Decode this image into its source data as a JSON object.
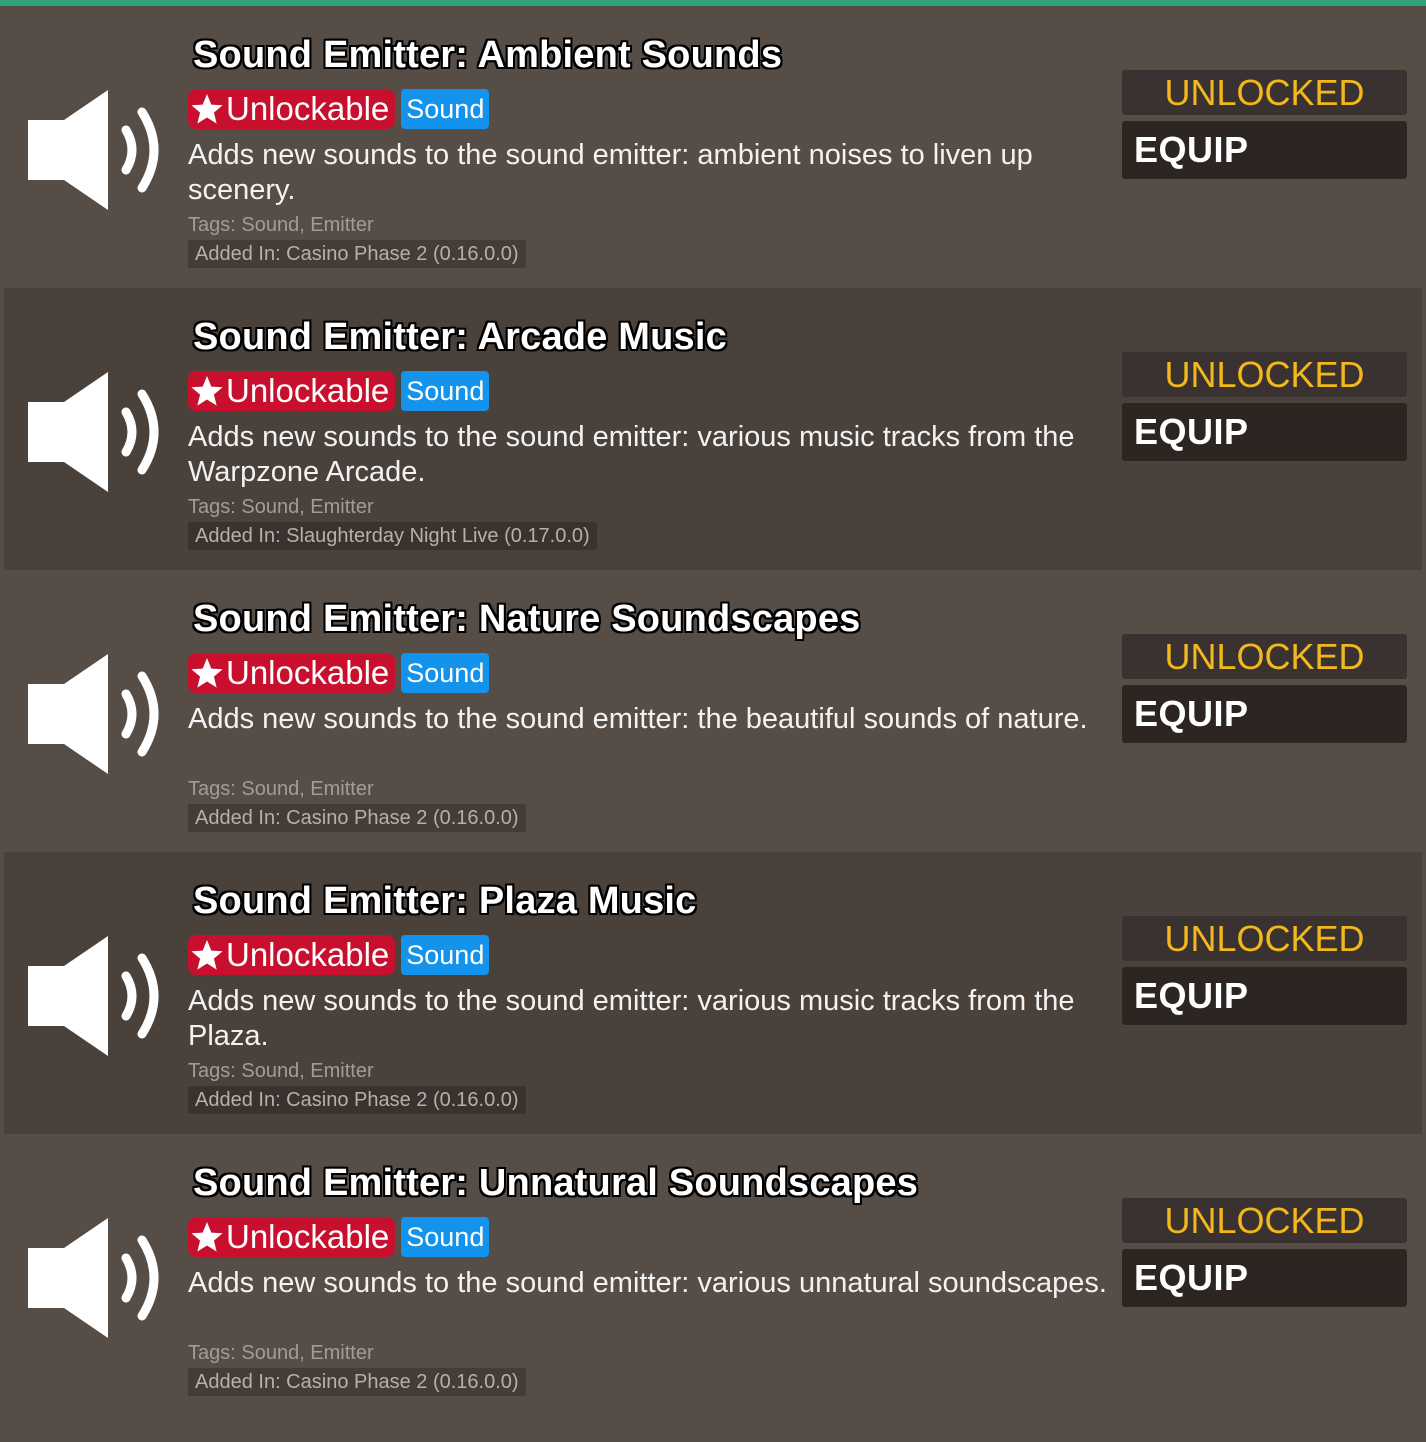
{
  "items": [
    {
      "title": "Sound Emitter: Ambient Sounds",
      "badge_unlockable": "Unlockable",
      "badge_category": "Sound",
      "description": "Adds new sounds to the sound emitter: ambient noises to liven up scenery.",
      "tags": "Tags: Sound, Emitter",
      "added_in": "Added In: Casino Phase 2 (0.16.0.0)",
      "status": "UNLOCKED",
      "equip_label": "EQUIP",
      "icon": "speaker-icon"
    },
    {
      "title": "Sound Emitter: Arcade Music",
      "badge_unlockable": "Unlockable",
      "badge_category": "Sound",
      "description": "Adds new sounds to the sound emitter: various music tracks from the Warpzone Arcade.",
      "tags": "Tags: Sound, Emitter",
      "added_in": "Added In: Slaughterday Night Live (0.17.0.0)",
      "status": "UNLOCKED",
      "equip_label": "EQUIP",
      "icon": "speaker-icon"
    },
    {
      "title": "Sound Emitter: Nature Soundscapes",
      "badge_unlockable": "Unlockable",
      "badge_category": "Sound",
      "description": "Adds new sounds to the sound emitter: the beautiful sounds of nature.",
      "tags": "Tags: Sound, Emitter",
      "added_in": "Added In: Casino Phase 2 (0.16.0.0)",
      "status": "UNLOCKED",
      "equip_label": "EQUIP",
      "icon": "speaker-icon"
    },
    {
      "title": "Sound Emitter: Plaza Music",
      "badge_unlockable": "Unlockable",
      "badge_category": "Sound",
      "description": "Adds new sounds to the sound emitter: various music tracks from the Plaza.",
      "tags": "Tags: Sound, Emitter",
      "added_in": "Added In: Casino Phase 2 (0.16.0.0)",
      "status": "UNLOCKED",
      "equip_label": "EQUIP",
      "icon": "speaker-icon"
    },
    {
      "title": "Sound Emitter: Unnatural Soundscapes",
      "badge_unlockable": "Unlockable",
      "badge_category": "Sound",
      "description": "Adds new sounds to the sound emitter: various unnatural soundscapes.",
      "tags": "Tags: Sound, Emitter",
      "added_in": "Added In: Casino Phase 2 (0.16.0.0)",
      "status": "UNLOCKED",
      "equip_label": "EQUIP",
      "icon": "speaker-icon"
    }
  ],
  "colors": {
    "accent_top": "#2fa37a",
    "unlockable_badge": "#c8102e",
    "category_badge": "#1393eb",
    "status_text": "#f2b81c"
  }
}
